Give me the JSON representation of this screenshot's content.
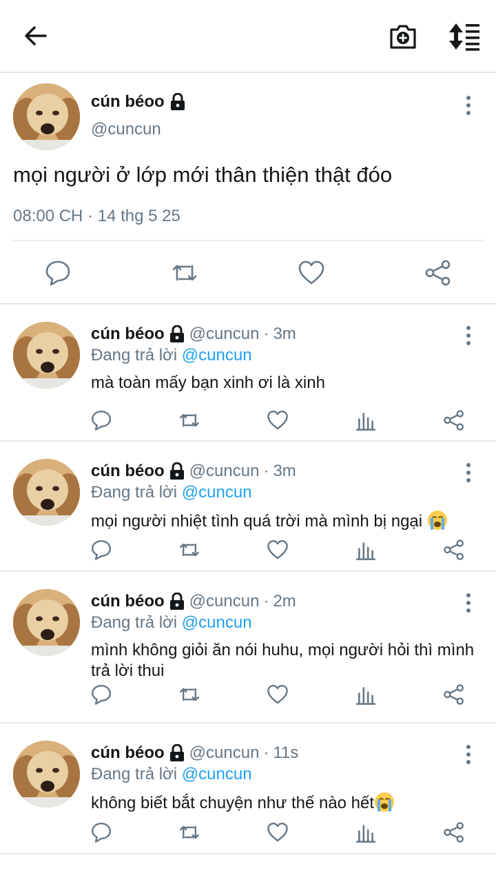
{
  "header": {
    "back_icon": "arrow-left-icon",
    "camera_icon": "camera-plus-icon",
    "sort_icon": "sort-lines-icon"
  },
  "main_tweet": {
    "display_name": "cún béoo",
    "handle": "@cuncun",
    "text": "mọi người ở lớp mới thân thiện thật đóo",
    "meta": "08:00 CH · 14 thg 5 25",
    "actions": [
      "reply-icon",
      "retweet-icon",
      "like-icon",
      "share-icon"
    ]
  },
  "replies": [
    {
      "display_name": "cún béoo",
      "handle": "@cuncun",
      "time": "3m",
      "replying_prefix": "Đang trả lời",
      "replying_to": "@cuncun",
      "text": "mà toàn mấy bạn xinh ơi là xinh",
      "emoji": ""
    },
    {
      "display_name": "cún béoo",
      "handle": "@cuncun",
      "time": "3m",
      "replying_prefix": "Đang trả lời",
      "replying_to": "@cuncun",
      "text": "mọi người nhiệt tình quá trời mà mình bị ngại ",
      "emoji": "crying-face-emoji"
    },
    {
      "display_name": "cún béoo",
      "handle": "@cuncun",
      "time": "2m",
      "replying_prefix": "Đang trả lời",
      "replying_to": "@cuncun",
      "text": "mình không giỏi ăn nói huhu, mọi người hỏi thì mình trả lời thui",
      "emoji": ""
    },
    {
      "display_name": "cún béoo",
      "handle": "@cuncun",
      "time": "11s",
      "replying_prefix": "Đang trả lời",
      "replying_to": "@cuncun",
      "text": "không biết bắt chuyện như thế nào hết",
      "emoji": "crying-face-emoji"
    }
  ],
  "colors": {
    "text": "#14171a",
    "secondary": "#657786",
    "mention": "#1da1f2",
    "divider": "#e4e6e8"
  }
}
